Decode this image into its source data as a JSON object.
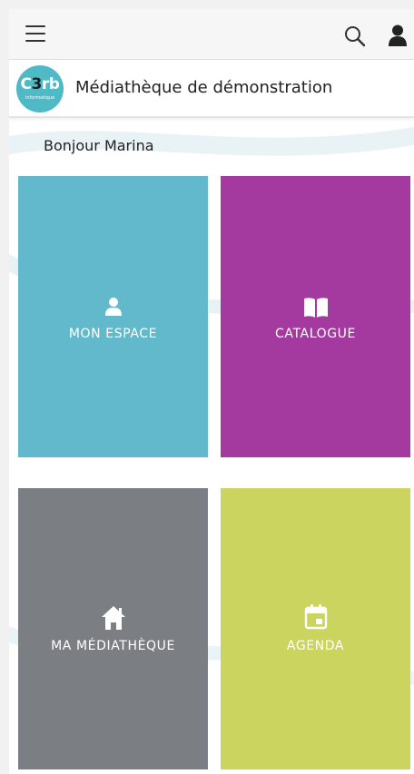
{
  "topbar": {
    "menu_icon": "hamburger-menu-icon",
    "search_icon": "search-icon",
    "user_icon": "user-icon"
  },
  "header": {
    "logo": {
      "main_prefix": "C",
      "main_digit": "3",
      "main_suffix": "rb",
      "sub": "informatique"
    },
    "title": "Médiathèque de démonstration"
  },
  "greeting": "Bonjour Marina",
  "tiles": [
    {
      "label": "MON ESPACE",
      "icon": "user-icon",
      "color": "#62b9cc"
    },
    {
      "label": "CATALOGUE",
      "icon": "open-book-icon",
      "color": "#a4399f"
    },
    {
      "label": "MA MÉDIATHÈQUE",
      "icon": "home-icon",
      "color": "#7b7e82"
    },
    {
      "label": "AGENDA",
      "icon": "calendar-icon",
      "color": "#ccd460"
    }
  ]
}
